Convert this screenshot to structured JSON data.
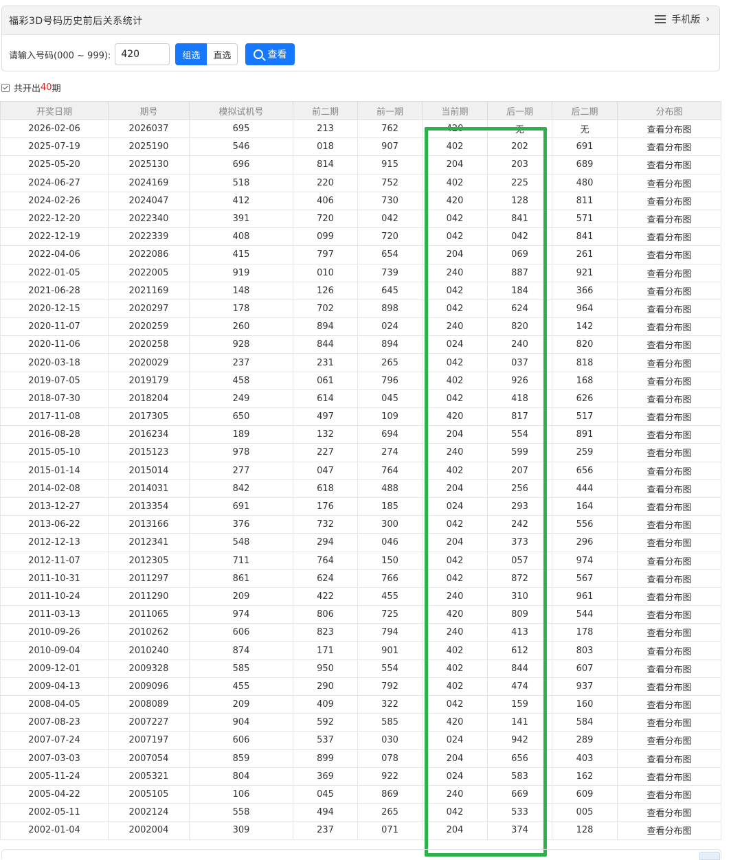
{
  "header": {
    "title": "福彩3D号码历史前后关系统计",
    "mobile_label": "手机版"
  },
  "form": {
    "label": "请输入号码(000 ~ 999):",
    "input_value": "420",
    "mode_group": "组选",
    "mode_direct": "直选",
    "view_label": "查看"
  },
  "summary": {
    "prefix": "共开出",
    "count": "40",
    "suffix": "期"
  },
  "table": {
    "headers": [
      "开奖日期",
      "期号",
      "模拟试机号",
      "前二期",
      "前一期",
      "当前期",
      "后一期",
      "后二期",
      "分布图"
    ],
    "rows": [
      [
        "2026-02-06",
        "2026037",
        "695",
        "213",
        "762",
        "420",
        "无",
        "无",
        "查看分布图"
      ],
      [
        "2025-07-19",
        "2025190",
        "546",
        "018",
        "907",
        "402",
        "202",
        "691",
        "查看分布图"
      ],
      [
        "2025-05-20",
        "2025130",
        "696",
        "814",
        "915",
        "204",
        "203",
        "689",
        "查看分布图"
      ],
      [
        "2024-06-27",
        "2024169",
        "518",
        "220",
        "752",
        "402",
        "225",
        "480",
        "查看分布图"
      ],
      [
        "2024-02-26",
        "2024047",
        "412",
        "406",
        "730",
        "420",
        "128",
        "811",
        "查看分布图"
      ],
      [
        "2022-12-20",
        "2022340",
        "391",
        "720",
        "042",
        "042",
        "841",
        "571",
        "查看分布图"
      ],
      [
        "2022-12-19",
        "2022339",
        "408",
        "099",
        "720",
        "042",
        "042",
        "841",
        "查看分布图"
      ],
      [
        "2022-04-06",
        "2022086",
        "415",
        "797",
        "654",
        "204",
        "069",
        "261",
        "查看分布图"
      ],
      [
        "2022-01-05",
        "2022005",
        "919",
        "010",
        "739",
        "240",
        "887",
        "921",
        "查看分布图"
      ],
      [
        "2021-06-28",
        "2021169",
        "148",
        "126",
        "645",
        "042",
        "184",
        "366",
        "查看分布图"
      ],
      [
        "2020-12-15",
        "2020297",
        "178",
        "702",
        "898",
        "042",
        "624",
        "964",
        "查看分布图"
      ],
      [
        "2020-11-07",
        "2020259",
        "260",
        "894",
        "024",
        "240",
        "820",
        "142",
        "查看分布图"
      ],
      [
        "2020-11-06",
        "2020258",
        "928",
        "844",
        "894",
        "024",
        "240",
        "820",
        "查看分布图"
      ],
      [
        "2020-03-18",
        "2020029",
        "237",
        "231",
        "265",
        "042",
        "037",
        "818",
        "查看分布图"
      ],
      [
        "2019-07-05",
        "2019179",
        "458",
        "061",
        "796",
        "402",
        "926",
        "168",
        "查看分布图"
      ],
      [
        "2018-07-30",
        "2018204",
        "249",
        "614",
        "045",
        "042",
        "418",
        "626",
        "查看分布图"
      ],
      [
        "2017-11-08",
        "2017305",
        "650",
        "497",
        "109",
        "420",
        "817",
        "517",
        "查看分布图"
      ],
      [
        "2016-08-28",
        "2016234",
        "189",
        "132",
        "694",
        "204",
        "554",
        "891",
        "查看分布图"
      ],
      [
        "2015-05-10",
        "2015123",
        "978",
        "227",
        "274",
        "240",
        "599",
        "259",
        "查看分布图"
      ],
      [
        "2015-01-14",
        "2015014",
        "277",
        "047",
        "764",
        "402",
        "207",
        "656",
        "查看分布图"
      ],
      [
        "2014-02-08",
        "2014031",
        "842",
        "618",
        "488",
        "204",
        "256",
        "444",
        "查看分布图"
      ],
      [
        "2013-12-27",
        "2013354",
        "691",
        "176",
        "185",
        "024",
        "293",
        "164",
        "查看分布图"
      ],
      [
        "2013-06-22",
        "2013166",
        "376",
        "732",
        "300",
        "042",
        "242",
        "556",
        "查看分布图"
      ],
      [
        "2012-12-13",
        "2012341",
        "548",
        "294",
        "046",
        "204",
        "373",
        "296",
        "查看分布图"
      ],
      [
        "2012-11-07",
        "2012305",
        "711",
        "764",
        "150",
        "042",
        "057",
        "974",
        "查看分布图"
      ],
      [
        "2011-10-31",
        "2011297",
        "861",
        "624",
        "766",
        "042",
        "872",
        "567",
        "查看分布图"
      ],
      [
        "2011-10-24",
        "2011290",
        "209",
        "422",
        "455",
        "240",
        "310",
        "961",
        "查看分布图"
      ],
      [
        "2011-03-13",
        "2011065",
        "974",
        "806",
        "725",
        "420",
        "809",
        "544",
        "查看分布图"
      ],
      [
        "2010-09-26",
        "2010262",
        "606",
        "823",
        "794",
        "240",
        "413",
        "178",
        "查看分布图"
      ],
      [
        "2010-09-04",
        "2010240",
        "874",
        "171",
        "901",
        "402",
        "612",
        "803",
        "查看分布图"
      ],
      [
        "2009-12-01",
        "2009328",
        "585",
        "950",
        "554",
        "402",
        "844",
        "607",
        "查看分布图"
      ],
      [
        "2009-04-13",
        "2009096",
        "455",
        "290",
        "792",
        "402",
        "474",
        "937",
        "查看分布图"
      ],
      [
        "2008-04-05",
        "2008089",
        "209",
        "409",
        "322",
        "042",
        "159",
        "160",
        "查看分布图"
      ],
      [
        "2007-08-23",
        "2007227",
        "904",
        "592",
        "585",
        "420",
        "141",
        "584",
        "查看分布图"
      ],
      [
        "2007-07-24",
        "2007197",
        "606",
        "537",
        "030",
        "024",
        "942",
        "289",
        "查看分布图"
      ],
      [
        "2007-03-03",
        "2007054",
        "859",
        "899",
        "078",
        "204",
        "656",
        "403",
        "查看分布图"
      ],
      [
        "2005-11-24",
        "2005321",
        "804",
        "369",
        "922",
        "024",
        "583",
        "162",
        "查看分布图"
      ],
      [
        "2005-04-22",
        "2005105",
        "106",
        "045",
        "869",
        "240",
        "669",
        "609",
        "查看分布图"
      ],
      [
        "2002-05-11",
        "2002124",
        "558",
        "494",
        "265",
        "042",
        "533",
        "005",
        "查看分布图"
      ],
      [
        "2002-01-04",
        "2002004",
        "309",
        "237",
        "071",
        "204",
        "374",
        "128",
        "查看分布图"
      ]
    ]
  },
  "colors": {
    "accent": "#1677ff",
    "highlight": "#2db24a",
    "count": "#e02020"
  }
}
